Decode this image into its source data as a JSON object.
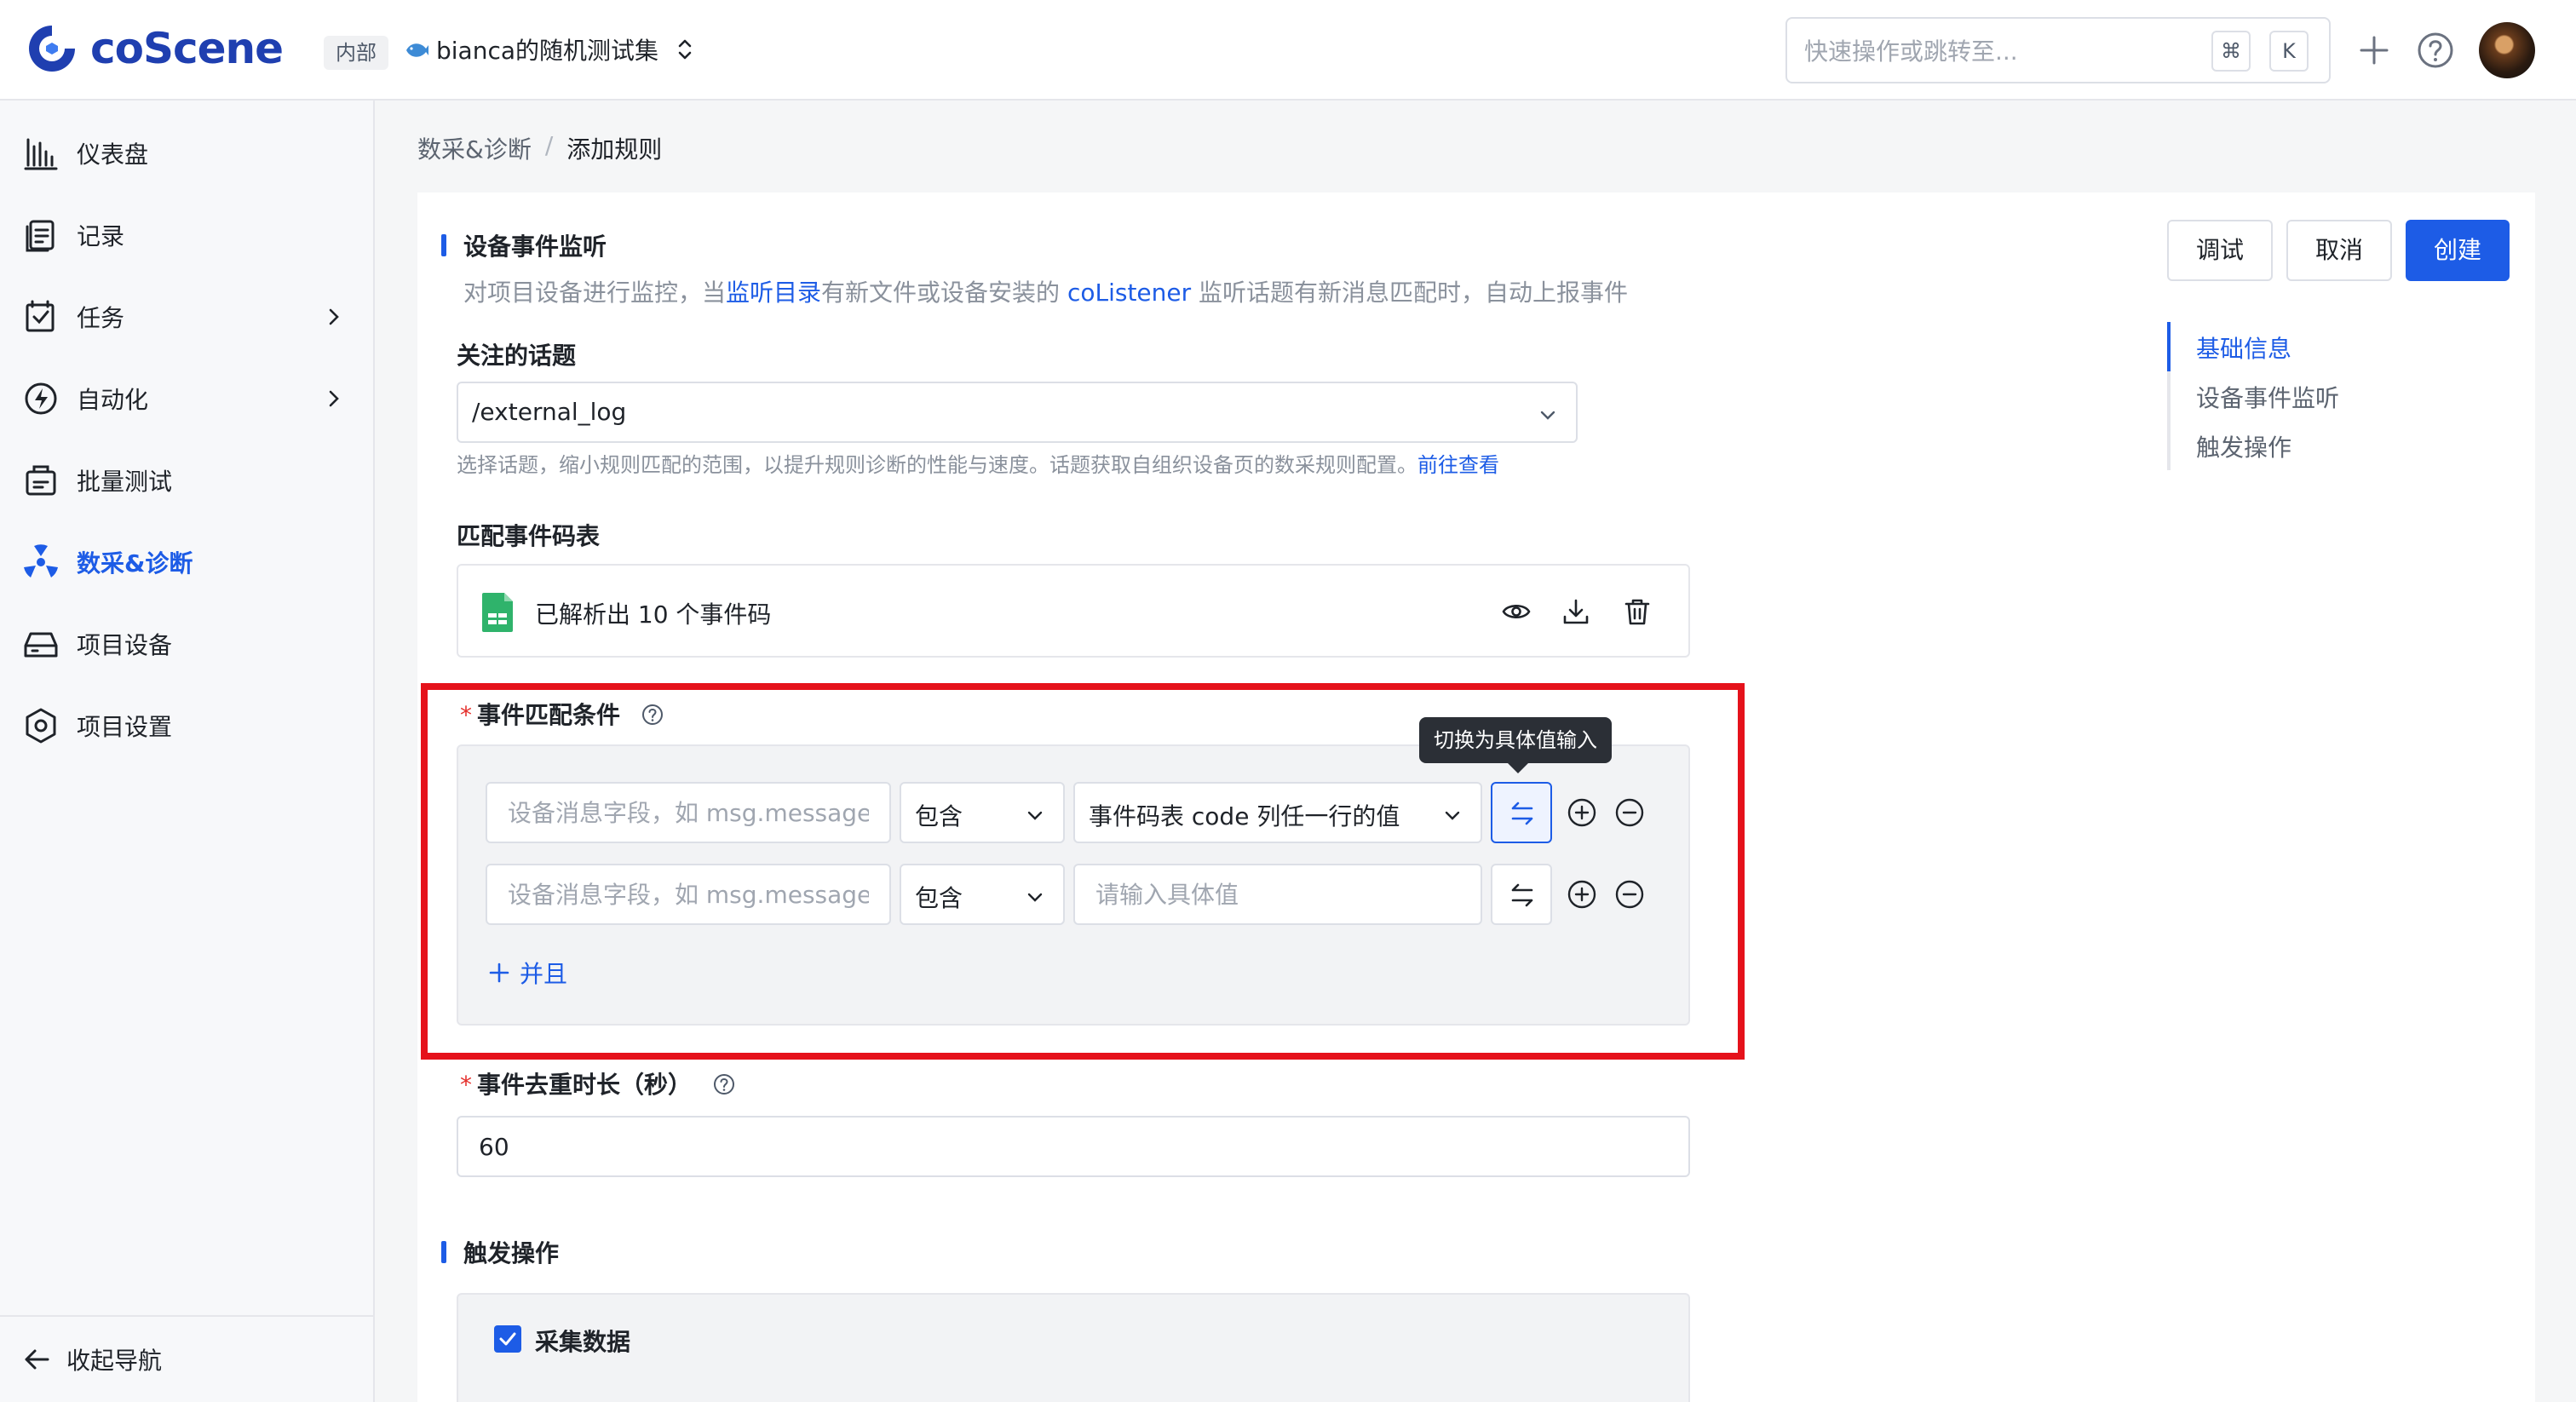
{
  "topbar": {
    "logo_text": "coScene",
    "workspace_badge": "内部",
    "project_name": "bianca的随机测试集",
    "search_placeholder": "快速操作或跳转至...",
    "shortcut_cmd": "⌘",
    "shortcut_key": "K"
  },
  "sidebar": {
    "items": [
      {
        "label": "仪表盘",
        "icon": "bar-chart-icon"
      },
      {
        "label": "记录",
        "icon": "records-icon"
      },
      {
        "label": "任务",
        "icon": "task-icon"
      },
      {
        "label": "自动化",
        "icon": "automation-icon"
      },
      {
        "label": "批量测试",
        "icon": "batch-test-icon"
      },
      {
        "label": "数采&诊断",
        "icon": "diagnosis-icon"
      },
      {
        "label": "项目设备",
        "icon": "device-icon"
      },
      {
        "label": "项目设置",
        "icon": "settings-icon"
      }
    ],
    "collapse_label": "收起导航"
  },
  "breadcrumb": {
    "parent": "数采&诊断",
    "separator": "/",
    "current": "添加规则"
  },
  "actions": {
    "debug": "调试",
    "cancel": "取消",
    "create": "创建"
  },
  "anchors": {
    "basic": "基础信息",
    "listen": "设备事件监听",
    "trigger": "触发操作"
  },
  "listen_section": {
    "title": "设备事件监听",
    "desc_prefix": "对项目设备进行监控，当",
    "desc_link1": "监听目录",
    "desc_mid": "有新文件或设备安装的",
    "desc_link2": "coListener",
    "desc_suffix": "监听话题有新消息匹配时，自动上报事件",
    "topic_label": "关注的话题",
    "topic_value": "/external_log",
    "topic_hint": "选择话题，缩小规则匹配的范围，以提升规则诊断的性能与速度。话题获取自组织设备页的数采规则配置。",
    "topic_hint_link": "前往查看",
    "code_table_label": "匹配事件码表",
    "code_table_file": "已解析出 10 个事件码",
    "condition_label": "事件匹配条件",
    "required_mark": "*",
    "conditions": [
      {
        "field_placeholder": "设备消息字段，如 msg.message",
        "op": "包含",
        "value": "事件码表 code 列任一行的值"
      },
      {
        "field_placeholder": "设备消息字段，如 msg.message",
        "op": "包含",
        "value_placeholder": "请输入具体值"
      }
    ],
    "tooltip": "切换为具体值输入",
    "and_label": "并且",
    "dedup_label": "事件去重时长（秒）",
    "dedup_value": "60"
  },
  "trigger_section": {
    "title": "触发操作",
    "collect_label": "采集数据"
  },
  "colors": {
    "primary": "#1d5ce6",
    "highlight": "#e5121b",
    "required": "#e5312d"
  }
}
